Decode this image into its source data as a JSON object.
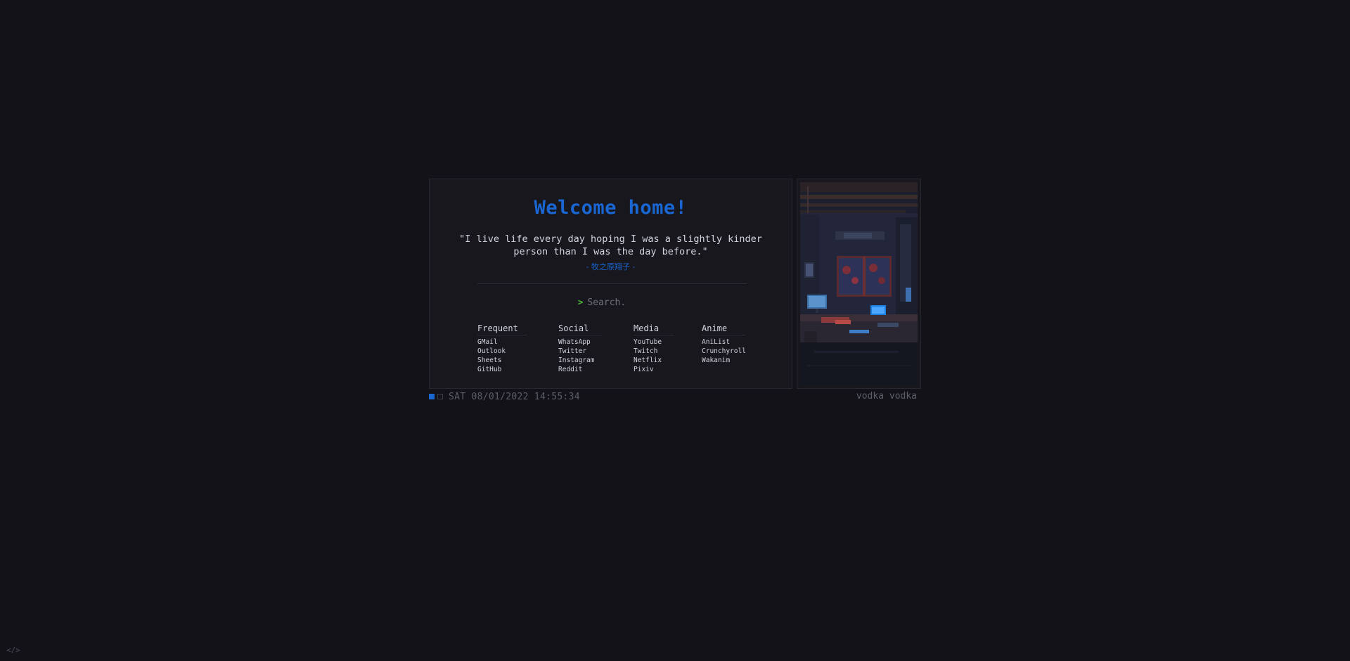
{
  "header": {
    "title": "Welcome home!"
  },
  "quote": {
    "text": "\"I live life every day hoping I was a slightly kinder person than I was the day before.\"",
    "author": "- 牧之原翔子 -"
  },
  "search": {
    "prompt_icon": "chevron-right-icon",
    "placeholder": "Search."
  },
  "columns": [
    {
      "title": "Frequent",
      "links": [
        "GMail",
        "Outlook",
        "Sheets",
        "GitHub"
      ]
    },
    {
      "title": "Social",
      "links": [
        "WhatsApp",
        "Twitter",
        "Instagram",
        "Reddit"
      ]
    },
    {
      "title": "Media",
      "links": [
        "YouTube",
        "Twitch",
        "Netflix",
        "Pixiv"
      ]
    },
    {
      "title": "Anime",
      "links": [
        "AniList",
        "Crunchyroll",
        "Wakanim"
      ]
    }
  ],
  "status": {
    "datetime": "SAT 08/01/2022 14:55:34",
    "username": "vodka vodka"
  },
  "footer": {
    "code_icon": "</>"
  },
  "colors": {
    "accent": "#1a66d2",
    "prompt": "#4caf38",
    "background": "#121218"
  }
}
